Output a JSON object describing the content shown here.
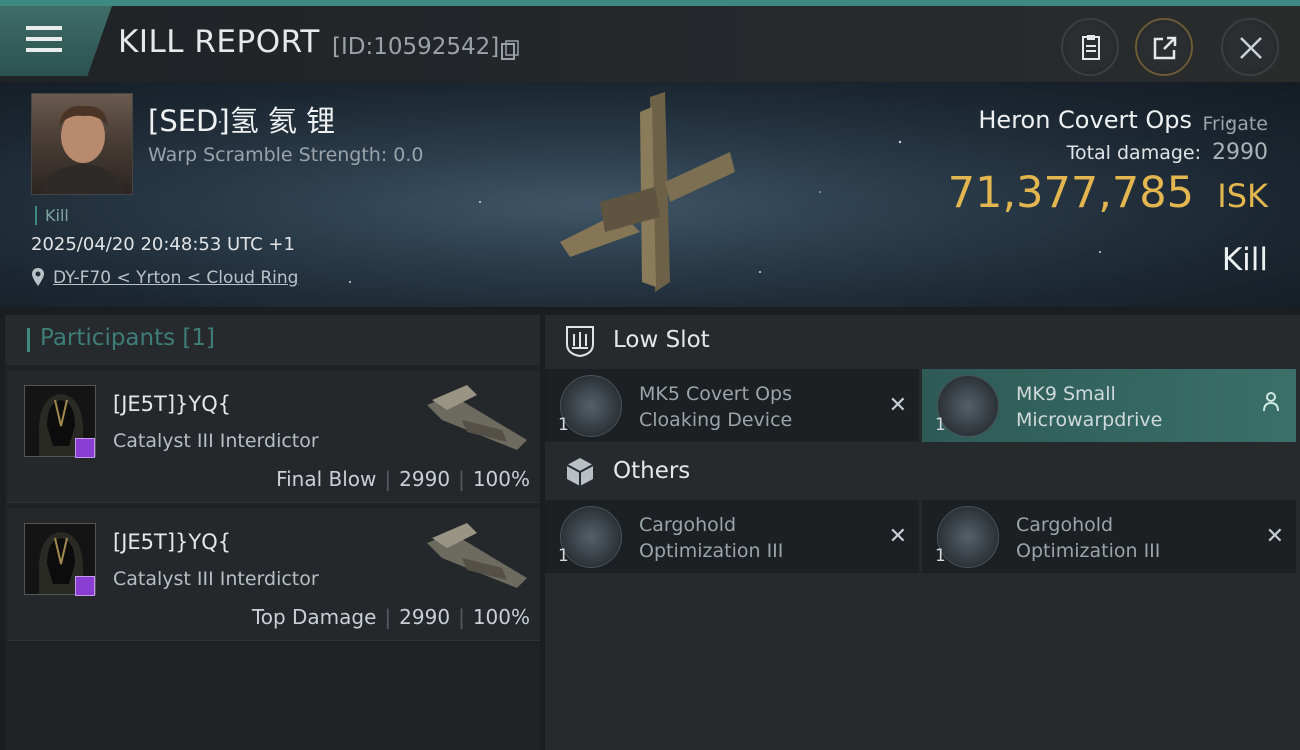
{
  "header": {
    "title": "KILL REPORT",
    "report_id": "[ID:10592542]",
    "icons": [
      "menu-icon",
      "copy-icon",
      "clipboard-icon",
      "share-icon",
      "close-icon"
    ]
  },
  "victim": {
    "pilot_name": "[SED]氢 氦 锂",
    "warp_scramble": "Warp Scramble Strength: 0.0",
    "kill_tag": "Kill",
    "datetime": "2025/04/20 20:48:53 UTC +1",
    "location": "DY-F70 < Yrton < Cloud Ring",
    "ship_name": "Heron Covert Ops",
    "ship_class": "Frigate",
    "total_damage_label": "Total damage:",
    "total_damage": "2990",
    "isk_value": "71,377,785",
    "isk_label": "ISK",
    "result": "Kill"
  },
  "participants": {
    "title": "Participants [1]",
    "list": [
      {
        "name": "[JE5T]}YQ{",
        "ship": "Catalyst III Interdictor",
        "role": "Final Blow",
        "damage": "2990",
        "percent": "100%"
      },
      {
        "name": "[JE5T]}YQ{",
        "ship": "Catalyst III Interdictor",
        "role": "Top Damage",
        "damage": "2990",
        "percent": "100%"
      }
    ]
  },
  "fittings": {
    "low_slot_title": "Low Slot",
    "others_title": "Others",
    "low_slot": [
      {
        "qty": "1",
        "line1": "MK5 Covert Ops",
        "line2": "Cloaking Device",
        "status": "destroyed"
      },
      {
        "qty": "1",
        "line1": "MK9 Small",
        "line2": "Microwarpdrive",
        "status": "dropped"
      }
    ],
    "others": [
      {
        "qty": "1",
        "line1": "Cargohold",
        "line2": "Optimization III",
        "status": "destroyed"
      },
      {
        "qty": "1",
        "line1": "Cargohold",
        "line2": "Optimization III",
        "status": "destroyed"
      }
    ]
  },
  "colors": {
    "accent": "#3c8a82",
    "isk": "#e3b64f",
    "badge": "#8a3dd1"
  }
}
